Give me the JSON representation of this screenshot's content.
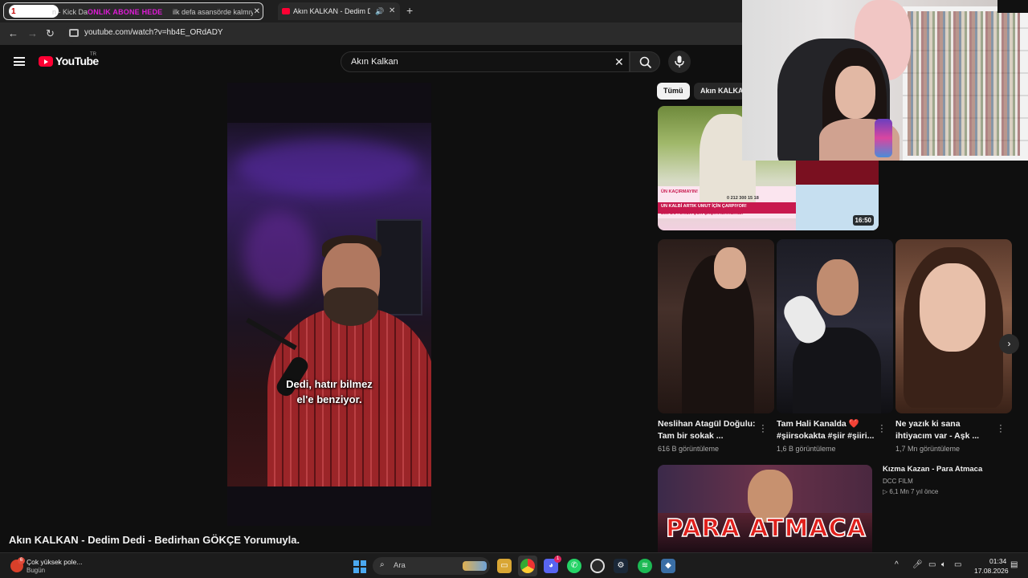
{
  "browser": {
    "tabs": [
      {
        "number": "1",
        "label": "n - Kick Da",
        "overlay_text": "ONLIK ABONE HEDE",
        "label_rest": "ilk defa asansörde kalmıy"
      },
      {
        "label": "Akın KALKAN - Dedim Dedi"
      }
    ],
    "new_tab": "+",
    "url": "youtube.com/watch?v=hb4E_ORdADY",
    "nav": {
      "back": "←",
      "forward": "→",
      "reload": "↻"
    }
  },
  "youtube": {
    "logo_text": "YouTube",
    "region": "TR",
    "search": {
      "value": "Akın Kalkan",
      "clear": "✕"
    },
    "video": {
      "title": "Akın KALKAN - Dedim Dedi - Bedirhan GÖKÇE Yorumuyla.",
      "subtitle_line1": "Dedi, hatır bilmez",
      "subtitle_line2": "el'e benziyor."
    },
    "chips": [
      "Tümü",
      "Akın KALKAN"
    ],
    "recommendations": {
      "top_thumb": {
        "duration": "16:50",
        "banner_text": "UN KALBİ ARTIK UMUT İÇİN ÇARPIYOR!",
        "banner_text2": "EMİ DUYUNCA ÇOK ŞAŞIRACAKSINIZ!",
        "phone": "0 212 300 15 18",
        "top_text": "ÜN KAÇIRMAYIN!"
      },
      "shorts": [
        {
          "title": "Neslihan Atagül Doğulu: Tam bir sokak ...",
          "views": "616 B görüntüleme"
        },
        {
          "title": "Tam Hali Kanalda ❤️ #şiirsokakta #şiir #şiiri...",
          "views": "1,6 B görüntüleme"
        },
        {
          "title": "Ne yazık ki sana ihtiyacım var - Aşk ...",
          "views": "1,7 Mn görüntüleme"
        }
      ],
      "next_arrow": "›",
      "video2": {
        "title": "Kızma Kazan - Para Atmaca",
        "channel": "DCC FILM",
        "meta": "▷ 6,1 Mn   7 yıl önce",
        "thumb_logo": "PARA ATMACA"
      }
    }
  },
  "taskbar": {
    "weather": {
      "title": "Çok yüksek pole...",
      "subtitle": "Bugün",
      "badge": "6"
    },
    "search_label": "Ara",
    "apps": [
      "file-explorer",
      "chrome",
      "discord",
      "whatsapp",
      "obs",
      "steam",
      "spotify",
      "other-app"
    ],
    "discord_badge": "1",
    "time": "01:34",
    "date": "17.08.2026"
  },
  "colors": {
    "background": "#0f0f0f",
    "yt_red": "#ff0033",
    "overlay_magenta": "#e01bd8"
  }
}
